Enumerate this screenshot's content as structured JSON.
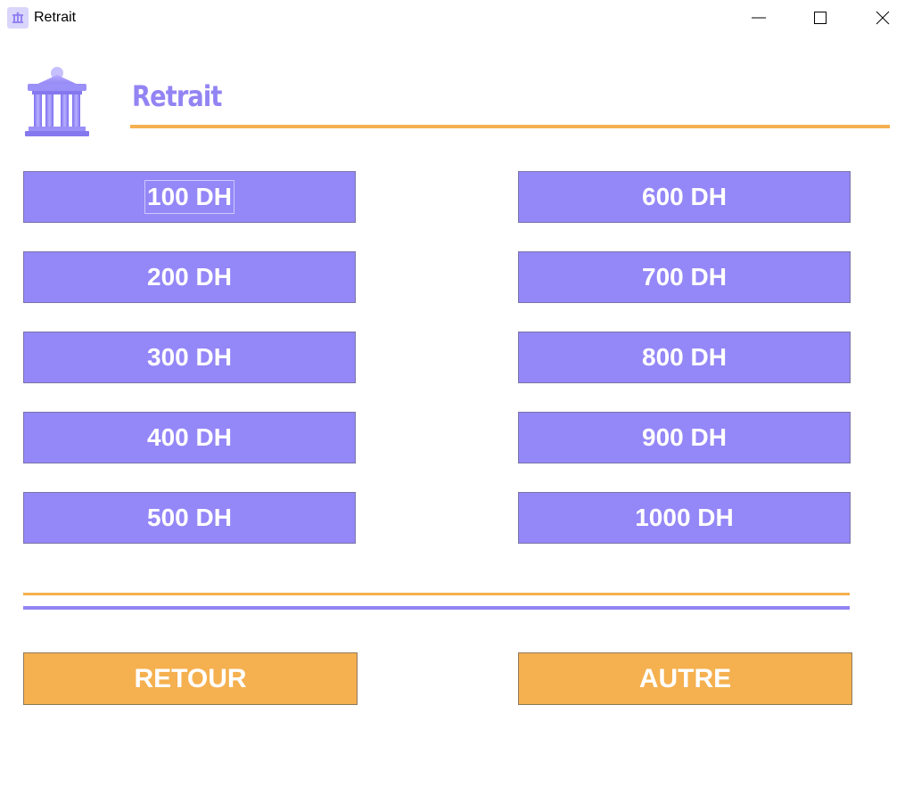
{
  "window": {
    "title": "Retrait",
    "controls": {
      "minimize_icon": "minimize-icon",
      "maximize_icon": "maximize-icon",
      "close_icon": "close-icon"
    }
  },
  "header": {
    "logo_icon": "bank-building-icon",
    "title": "Retrait"
  },
  "amounts": {
    "left": [
      "100 DH",
      "200 DH",
      "300 DH",
      "400 DH",
      "500 DH"
    ],
    "right": [
      "600 DH",
      "700 DH",
      "800 DH",
      "900 DH",
      "1000 DH"
    ],
    "focused": "100 DH"
  },
  "actions": {
    "back_label": "RETOUR",
    "other_label": "AUTRE"
  },
  "colors": {
    "primary_purple": "#9487f7",
    "title_purple": "#9284f3",
    "accent_orange": "#f5b04f",
    "button_text": "#ffffff"
  }
}
